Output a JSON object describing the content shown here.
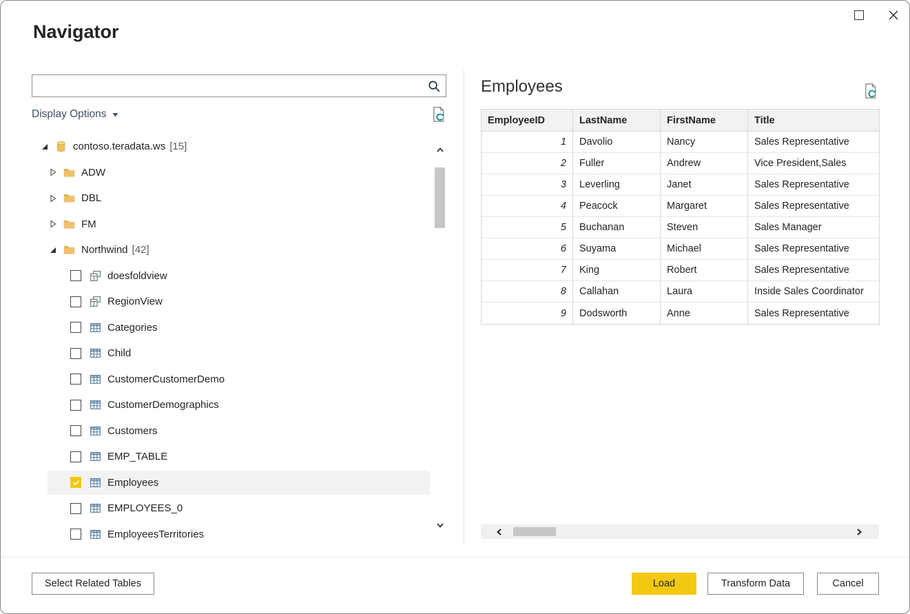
{
  "window": {
    "title": "Navigator"
  },
  "left_panel": {
    "search": {
      "value": "",
      "placeholder": ""
    },
    "display_options_label": "Display Options",
    "tree": {
      "items": [
        {
          "label": "contoso.teradata.ws",
          "count": "[15]",
          "kind": "database",
          "level": 0,
          "expanded": true
        },
        {
          "label": "ADW",
          "kind": "folder",
          "level": 1,
          "expanded": false
        },
        {
          "label": "DBL",
          "kind": "folder",
          "level": 1,
          "expanded": false
        },
        {
          "label": "FM",
          "kind": "folder",
          "level": 1,
          "expanded": false
        },
        {
          "label": "Northwind",
          "count": "[42]",
          "kind": "folder",
          "level": 1,
          "expanded": true
        },
        {
          "label": "doesfoldview",
          "kind": "view",
          "level": 2,
          "checked": false
        },
        {
          "label": "RegionView",
          "kind": "view",
          "level": 2,
          "checked": false
        },
        {
          "label": "Categories",
          "kind": "table",
          "level": 2,
          "checked": false
        },
        {
          "label": "Child",
          "kind": "table",
          "level": 2,
          "checked": false
        },
        {
          "label": "CustomerCustomerDemo",
          "kind": "table",
          "level": 2,
          "checked": false
        },
        {
          "label": "CustomerDemographics",
          "kind": "table",
          "level": 2,
          "checked": false
        },
        {
          "label": "Customers",
          "kind": "table",
          "level": 2,
          "checked": false
        },
        {
          "label": "EMP_TABLE",
          "kind": "table",
          "level": 2,
          "checked": false
        },
        {
          "label": "Employees",
          "kind": "table",
          "level": 2,
          "checked": true,
          "selected": true
        },
        {
          "label": "EMPLOYEES_0",
          "kind": "table",
          "level": 2,
          "checked": false
        },
        {
          "label": "EmployeesTerritories",
          "kind": "table",
          "level": 2,
          "checked": false
        }
      ]
    }
  },
  "preview": {
    "title": "Employees",
    "columns": [
      "EmployeeID",
      "LastName",
      "FirstName",
      "Title"
    ],
    "rows": [
      [
        "1",
        "Davolio",
        "Nancy",
        "Sales Representative"
      ],
      [
        "2",
        "Fuller",
        "Andrew",
        "Vice President,Sales"
      ],
      [
        "3",
        "Leverling",
        "Janet",
        "Sales Representative"
      ],
      [
        "4",
        "Peacock",
        "Margaret",
        "Sales Representative"
      ],
      [
        "5",
        "Buchanan",
        "Steven",
        "Sales Manager"
      ],
      [
        "6",
        "Suyama",
        "Michael",
        "Sales Representative"
      ],
      [
        "7",
        "King",
        "Robert",
        "Sales Representative"
      ],
      [
        "8",
        "Callahan",
        "Laura",
        "Inside Sales Coordinator"
      ],
      [
        "9",
        "Dodsworth",
        "Anne",
        "Sales Representative"
      ]
    ]
  },
  "footer": {
    "select_related_label": "Select Related Tables",
    "load_label": "Load",
    "transform_label": "Transform Data",
    "cancel_label": "Cancel"
  },
  "colors": {
    "accent": "#F2C811",
    "selected_row": "#F3F2F1",
    "folder_icon": "#F0C36E",
    "refresh_icon_teal": "#038387",
    "table_icon_blue": "#5B7E9E",
    "header_bg": "#F3F2F1",
    "border": "#8A8886",
    "text": "#252423"
  },
  "icons": {
    "search": "magnifier",
    "refresh": "page-with-refresh-arrows",
    "expanded": "filled-triangle-down-right",
    "collapsed": "outline-triangle-right",
    "database": "cylinder",
    "folder": "folder",
    "view": "layered-sheets",
    "table": "grid",
    "maximize": "square-outline",
    "close": "x",
    "dropdown": "caret-down",
    "scrollbar": "chevron-arrows"
  }
}
